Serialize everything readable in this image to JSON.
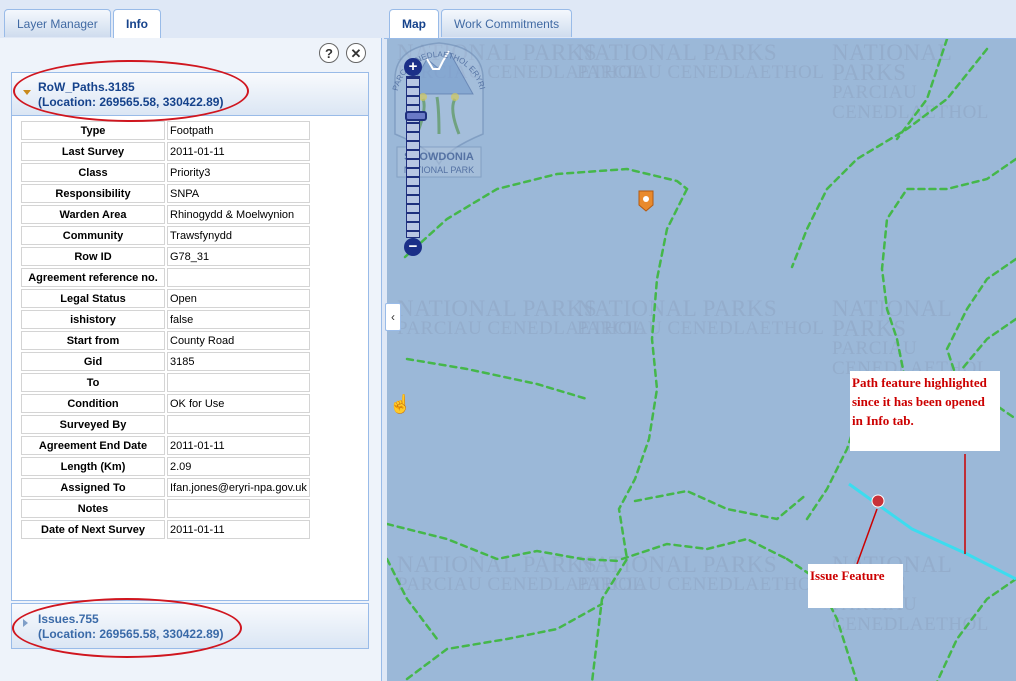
{
  "left_tabs": [
    {
      "label": "Layer Manager"
    },
    {
      "label": "Info"
    }
  ],
  "toolbar": {
    "help_glyph": "?",
    "close_glyph": "✕"
  },
  "panel1": {
    "title": "RoW_Paths.3185",
    "location": "(Location: 269565.58, 330422.89)",
    "rows": [
      {
        "key": "Type",
        "value": "Footpath"
      },
      {
        "key": "Last Survey",
        "value": "2011-01-11"
      },
      {
        "key": "Class",
        "value": "Priority3"
      },
      {
        "key": "Responsibility",
        "value": "SNPA"
      },
      {
        "key": "Warden Area",
        "value": "Rhinogydd & Moelwynion"
      },
      {
        "key": "Community",
        "value": "Trawsfynydd"
      },
      {
        "key": "Row ID",
        "value": "G78_31"
      },
      {
        "key": "Agreement reference no.",
        "value": ""
      },
      {
        "key": "Legal Status",
        "value": "Open"
      },
      {
        "key": "ishistory",
        "value": "false"
      },
      {
        "key": "Start from",
        "value": "County Road"
      },
      {
        "key": "Gid",
        "value": "3185"
      },
      {
        "key": "To",
        "value": ""
      },
      {
        "key": "Condition",
        "value": "OK for Use"
      },
      {
        "key": "Surveyed By",
        "value": ""
      },
      {
        "key": "Agreement End Date",
        "value": "2011-01-11"
      },
      {
        "key": "Length (Km)",
        "value": "2.09"
      },
      {
        "key": "Assigned To",
        "value": "Ifan.jones@eryri-npa.gov.uk"
      },
      {
        "key": "Notes",
        "value": ""
      },
      {
        "key": "Date of Next Survey",
        "value": "2011-01-11"
      }
    ]
  },
  "panel2": {
    "title": "Issues.755",
    "location": "(Location: 269565.58, 330422.89)"
  },
  "map_tabs": [
    {
      "label": "Map"
    },
    {
      "label": "Work Commitments"
    }
  ],
  "zoom": {
    "plus": "+",
    "minus": "−"
  },
  "collapse_glyph": "‹",
  "watermark": {
    "line1": "NATIONAL PARKS",
    "line2": "PARCIAU CENEDLAETHOL"
  },
  "logo": {
    "arc_text": "PARC CENEDLAETHOL ERYRI",
    "line1": "SNOWDONIA",
    "line2": "NATIONAL PARK"
  },
  "annotations": {
    "path_note": "Path feature highlighted since it has been opened in Info tab.",
    "issue_note": "Issue Feature"
  },
  "colors": {
    "map_bg": "#9bb8d8",
    "path_green": "#45b74a",
    "highlight_cyan": "#3cdcef",
    "annotation_red": "#cc0000",
    "tab_text": "#15428b"
  }
}
